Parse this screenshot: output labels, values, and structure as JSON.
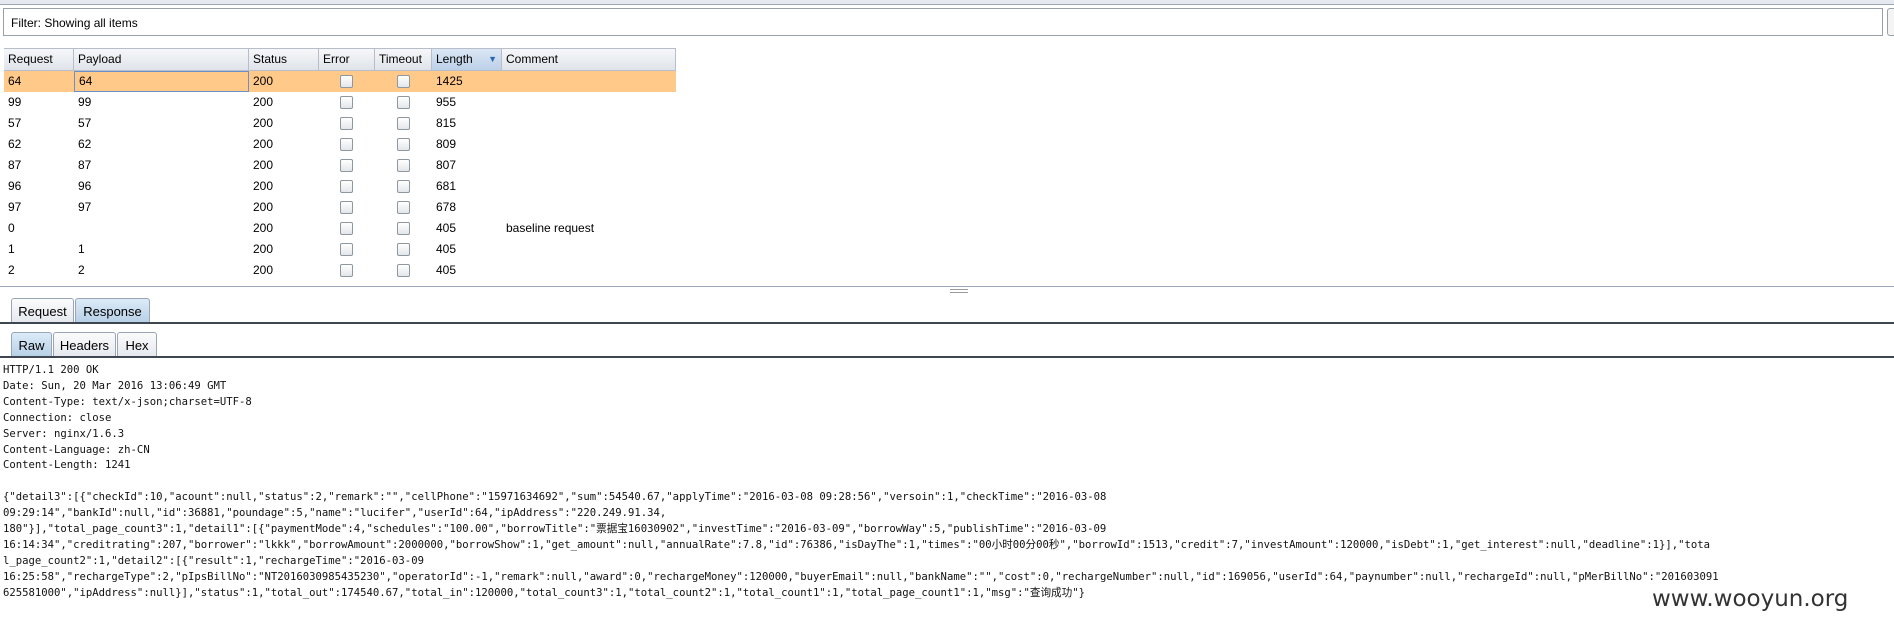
{
  "filter": {
    "label": "Filter: Showing all items"
  },
  "table": {
    "columns": [
      "Request",
      "Payload",
      "Status",
      "Error",
      "Timeout",
      "Length",
      "Comment"
    ],
    "sorted_column": "Length",
    "rows": [
      {
        "request": "64",
        "payload": "64",
        "status": "200",
        "error": false,
        "timeout": false,
        "length": "1425",
        "comment": "",
        "selected": true
      },
      {
        "request": "99",
        "payload": "99",
        "status": "200",
        "error": false,
        "timeout": false,
        "length": "955",
        "comment": ""
      },
      {
        "request": "57",
        "payload": "57",
        "status": "200",
        "error": false,
        "timeout": false,
        "length": "815",
        "comment": ""
      },
      {
        "request": "62",
        "payload": "62",
        "status": "200",
        "error": false,
        "timeout": false,
        "length": "809",
        "comment": ""
      },
      {
        "request": "87",
        "payload": "87",
        "status": "200",
        "error": false,
        "timeout": false,
        "length": "807",
        "comment": ""
      },
      {
        "request": "96",
        "payload": "96",
        "status": "200",
        "error": false,
        "timeout": false,
        "length": "681",
        "comment": ""
      },
      {
        "request": "97",
        "payload": "97",
        "status": "200",
        "error": false,
        "timeout": false,
        "length": "678",
        "comment": ""
      },
      {
        "request": "0",
        "payload": "",
        "status": "200",
        "error": false,
        "timeout": false,
        "length": "405",
        "comment": "baseline request"
      },
      {
        "request": "1",
        "payload": "1",
        "status": "200",
        "error": false,
        "timeout": false,
        "length": "405",
        "comment": ""
      },
      {
        "request": "2",
        "payload": "2",
        "status": "200",
        "error": false,
        "timeout": false,
        "length": "405",
        "comment": ""
      }
    ]
  },
  "tabs": {
    "request": "Request",
    "response": "Response"
  },
  "view_tabs": {
    "raw": "Raw",
    "headers": "Headers",
    "hex": "Hex"
  },
  "response_lines": [
    "HTTP/1.1 200 OK",
    "Date: Sun, 20 Mar 2016 13:06:49 GMT",
    "Content-Type: text/x-json;charset=UTF-8",
    "Connection: close",
    "Server: nginx/1.6.3",
    "Content-Language: zh-CN",
    "Content-Length: 1241",
    "",
    "{\"detail3\":[{\"checkId\":10,\"acount\":null,\"status\":2,\"remark\":\"\",\"cellPhone\":\"15971634692\",\"sum\":54540.67,\"applyTime\":\"2016-03-08 09:28:56\",\"versoin\":1,\"checkTime\":\"2016-03-08",
    "09:29:14\",\"bankId\":null,\"id\":36881,\"poundage\":5,\"name\":\"lucifer\",\"userId\":64,\"ipAddress\":\"220.249.91.34,",
    "180\"}],\"total_page_count3\":1,\"detail1\":[{\"paymentMode\":4,\"schedules\":\"100.00\",\"borrowTitle\":\"票据宝16030902\",\"investTime\":\"2016-03-09\",\"borrowWay\":5,\"publishTime\":\"2016-03-09",
    "16:14:34\",\"creditrating\":207,\"borrower\":\"lkkk\",\"borrowAmount\":2000000,\"borrowShow\":1,\"get_amount\":null,\"annualRate\":7.8,\"id\":76386,\"isDayThe\":1,\"times\":\"00小时00分00秒\",\"borrowId\":1513,\"credit\":7,\"investAmount\":120000,\"isDebt\":1,\"get_interest\":null,\"deadline\":1}],\"tota",
    "l_page_count2\":1,\"detail2\":[{\"result\":1,\"rechargeTime\":\"2016-03-09",
    "16:25:58\",\"rechargeType\":2,\"pIpsBillNo\":\"NT2016030985435230\",\"operatorId\":-1,\"remark\":null,\"award\":0,\"rechargeMoney\":120000,\"buyerEmail\":null,\"bankName\":\"\",\"cost\":0,\"rechargeNumber\":null,\"id\":169056,\"userId\":64,\"paynumber\":null,\"rechargeId\":null,\"pMerBillNo\":\"201603091",
    "625581000\",\"ipAddress\":null}],\"status\":1,\"total_out\":174540.67,\"total_in\":120000,\"total_count3\":1,\"total_count2\":1,\"total_count1\":1,\"total_page_count1\":1,\"msg\":\"查询成功\"}"
  ],
  "watermark": "www.wooyun.org"
}
